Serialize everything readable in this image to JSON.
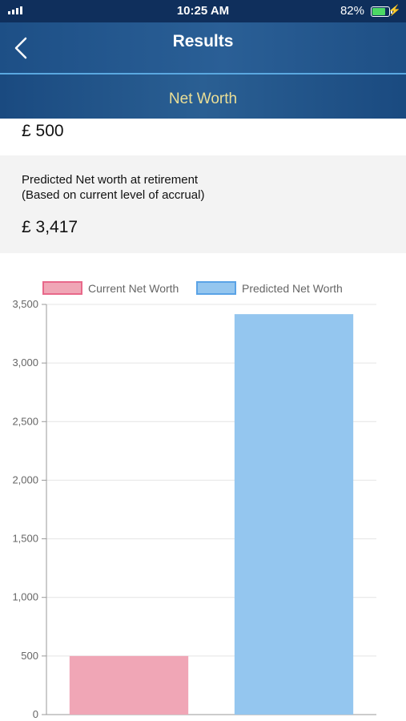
{
  "status_bar": {
    "time": "10:25 AM",
    "battery_percent": "82%",
    "battery_level": 0.82,
    "icons": [
      "signal-icon",
      "battery-icon",
      "charging-bolt-icon"
    ]
  },
  "nav": {
    "title": "Results",
    "back_icon": "back-chevron-icon",
    "section_title": "Net Worth"
  },
  "colors": {
    "header": "#1f5289",
    "section_title": "#ecdf96",
    "current_bar": "#f0a6b6",
    "current_border": "#e8688a",
    "predicted_bar": "#94c6ef",
    "predicted_border": "#5aa3e6"
  },
  "summary": {
    "current_value": "£ 500",
    "predicted_label_line1": "Predicted Net worth at retirement",
    "predicted_label_line2": "(Based on current level of accrual)",
    "predicted_value": "£ 3,417"
  },
  "chart_data": {
    "type": "bar",
    "title": "",
    "xlabel": "",
    "ylabel": "",
    "categories": [
      "Current Net Worth",
      "Predicted Net Worth"
    ],
    "values": [
      500,
      3417
    ],
    "ylim": [
      0,
      3500
    ],
    "y_ticks": [
      0,
      500,
      1000,
      1500,
      2000,
      2500,
      3000,
      3500
    ],
    "y_tick_labels": [
      "0",
      "500",
      "1,000",
      "1,500",
      "2,000",
      "2,500",
      "3,000",
      "3,500"
    ],
    "legend": [
      "Current Net Worth",
      "Predicted Net Worth"
    ],
    "legend_position": "top",
    "grid": true
  }
}
